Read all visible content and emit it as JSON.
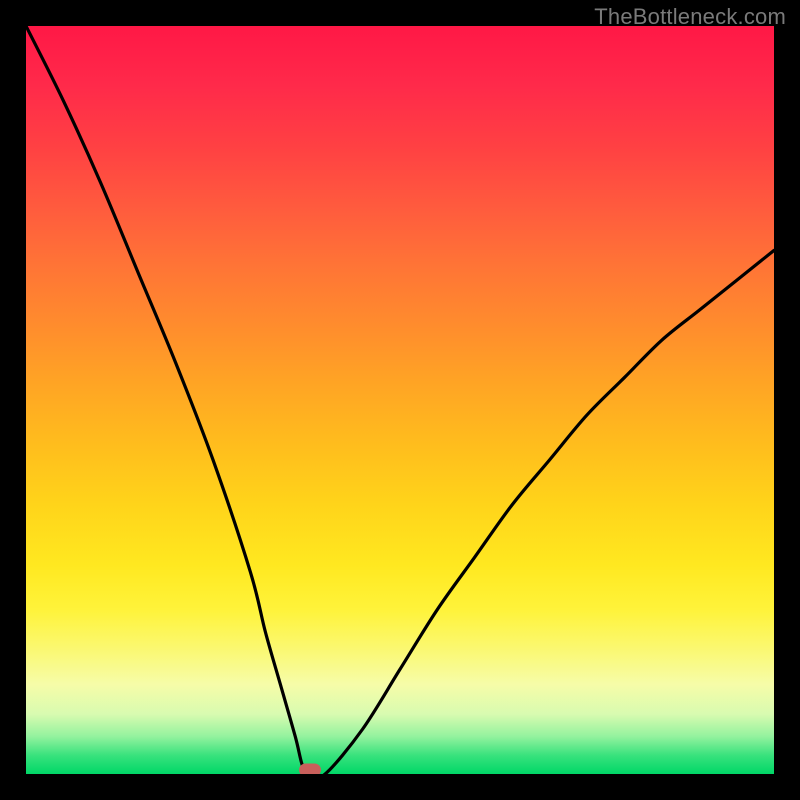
{
  "watermark": "TheBottleneck.com",
  "chart_data": {
    "type": "line",
    "title": "",
    "xlabel": "",
    "ylabel": "",
    "xlim": [
      0,
      100
    ],
    "ylim": [
      0,
      100
    ],
    "x": [
      0,
      5,
      10,
      15,
      20,
      25,
      30,
      32,
      34,
      36,
      37,
      38,
      40,
      45,
      50,
      55,
      60,
      65,
      70,
      75,
      80,
      85,
      90,
      95,
      100
    ],
    "values": [
      100,
      90,
      79,
      67,
      55,
      42,
      27,
      19,
      12,
      5,
      1,
      0,
      0,
      6,
      14,
      22,
      29,
      36,
      42,
      48,
      53,
      58,
      62,
      66,
      70
    ],
    "series": [
      {
        "name": "bottleneck-curve",
        "x_ref": "x",
        "y_ref": "values"
      }
    ],
    "marker": {
      "x": 38,
      "y": 0,
      "color": "#c85f5b"
    },
    "background_gradient": {
      "top": "#ff1846",
      "mid": "#ffe820",
      "bottom": "#00d767"
    },
    "curve_stroke": "#000000"
  }
}
